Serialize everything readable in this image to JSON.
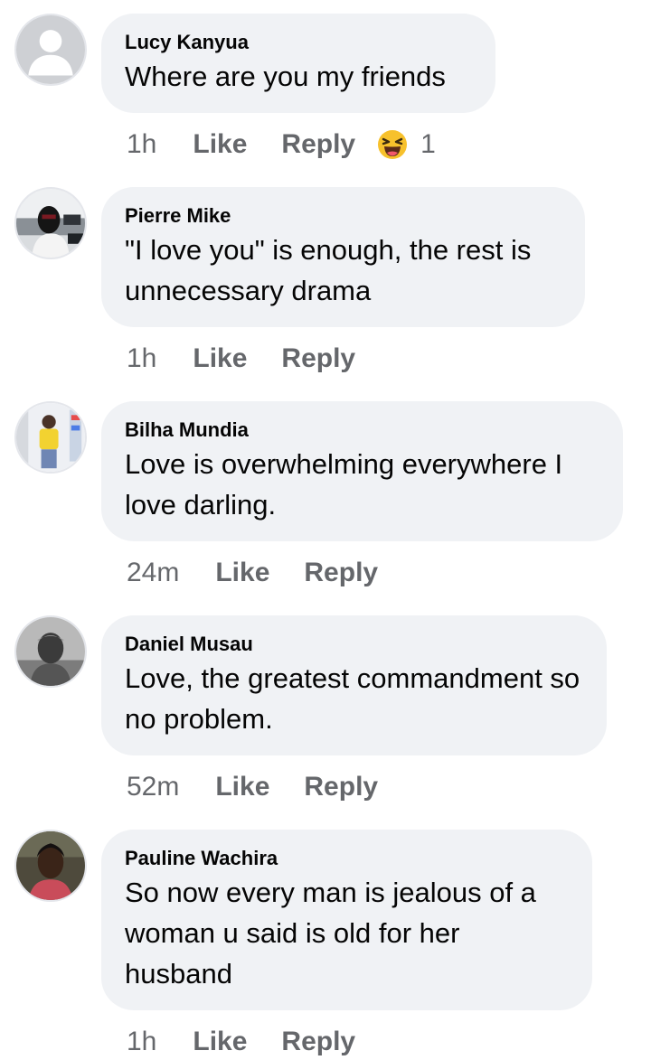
{
  "comments": [
    {
      "author": "Lucy Kanyua",
      "text": "Where are you my friends",
      "time": "1h",
      "like": "Like",
      "reply": "Reply",
      "avatar": "default-avatar",
      "reaction": {
        "icon": "haha-icon",
        "count": "1"
      }
    },
    {
      "author": "Pierre Mike",
      "text": "\"I love you\" is enough, the rest is unnecessary drama",
      "time": "1h",
      "like": "Like",
      "reply": "Reply",
      "avatar": "profile-photo"
    },
    {
      "author": "Bilha Mundia",
      "text": "Love is overwhelming everywhere I love darling.",
      "time": "24m",
      "like": "Like",
      "reply": "Reply",
      "avatar": "profile-photo"
    },
    {
      "author": "Daniel Musau",
      "text": "Love, the greatest commandment so no problem.",
      "time": "52m",
      "like": "Like",
      "reply": "Reply",
      "avatar": "profile-photo"
    },
    {
      "author": "Pauline Wachira",
      "text": "So now every man is jealous of a woman u said is old for her husband",
      "time": "1h",
      "like": "Like",
      "reply": "Reply",
      "avatar": "profile-photo"
    }
  ],
  "colors": {
    "bubble": "#f0f2f5",
    "text": "#050505",
    "secondary": "#65676b"
  }
}
